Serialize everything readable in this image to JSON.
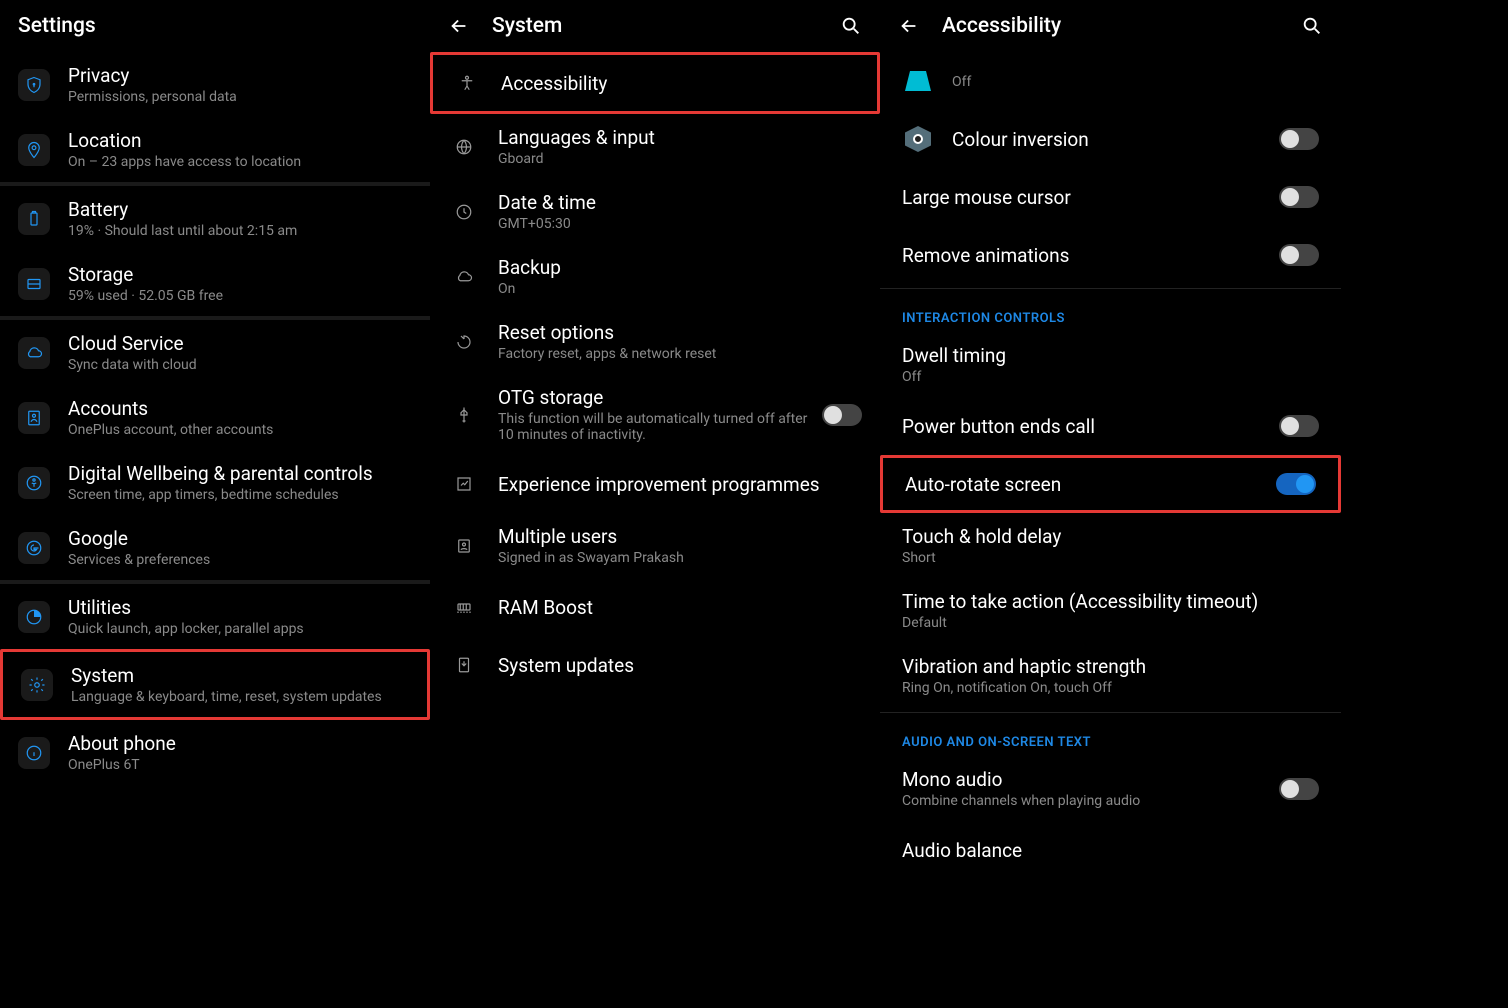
{
  "pane1": {
    "title": "Settings",
    "items": [
      {
        "title": "Privacy",
        "sub": "Permissions, personal data",
        "icon": "shield"
      },
      {
        "title": "Location",
        "sub": "On – 23 apps have access to location",
        "icon": "location"
      },
      {
        "divider": true
      },
      {
        "title": "Battery",
        "sub": "19% · Should last until about 2:15 am",
        "icon": "battery"
      },
      {
        "title": "Storage",
        "sub": "59% used · 52.05 GB free",
        "icon": "storage"
      },
      {
        "divider": true
      },
      {
        "title": "Cloud Service",
        "sub": "Sync data with cloud",
        "icon": "cloud"
      },
      {
        "title": "Accounts",
        "sub": "OnePlus account, other accounts",
        "icon": "accounts"
      },
      {
        "title": "Digital Wellbeing & parental controls",
        "sub": "Screen time, app timers, bedtime schedules",
        "icon": "wellbeing"
      },
      {
        "title": "Google",
        "sub": "Services & preferences",
        "icon": "google"
      },
      {
        "divider": true
      },
      {
        "title": "Utilities",
        "sub": "Quick launch, app locker, parallel apps",
        "icon": "utilities"
      },
      {
        "title": "System",
        "sub": "Language & keyboard, time, reset, system updates",
        "icon": "system",
        "highlight": true
      },
      {
        "title": "About phone",
        "sub": "OnePlus 6T",
        "icon": "info"
      }
    ]
  },
  "pane2": {
    "title": "System",
    "items": [
      {
        "title": "Accessibility",
        "icon": "accessibility",
        "highlight": true
      },
      {
        "title": "Languages & input",
        "sub": "Gboard",
        "icon": "globe"
      },
      {
        "title": "Date & time",
        "sub": "GMT+05:30",
        "icon": "clock"
      },
      {
        "title": "Backup",
        "sub": "On",
        "icon": "cloud"
      },
      {
        "title": "Reset options",
        "sub": "Factory reset, apps & network reset",
        "icon": "reset"
      },
      {
        "title": "OTG storage",
        "sub": "This function will be automatically turned off after 10 minutes of inactivity.",
        "icon": "usb",
        "toggle": "off"
      },
      {
        "title": "Experience improvement programmes",
        "icon": "chart"
      },
      {
        "title": "Multiple users",
        "sub": "Signed in as Swayam Prakash",
        "icon": "users"
      },
      {
        "title": "RAM Boost",
        "icon": "ram"
      },
      {
        "title": "System updates",
        "icon": "download"
      }
    ]
  },
  "pane3": {
    "title": "Accessibility",
    "groups": [
      {
        "items": [
          {
            "title": "",
            "sub": "Off",
            "shape": "trapezoid"
          },
          {
            "title": "Colour inversion",
            "shape": "hexagon",
            "toggle": "off"
          },
          {
            "title": "Large mouse cursor",
            "toggle": "off"
          },
          {
            "title": "Remove animations",
            "toggle": "off"
          }
        ]
      },
      {
        "header": "INTERACTION CONTROLS",
        "items": [
          {
            "title": "Dwell timing",
            "sub": "Off"
          },
          {
            "title": "Power button ends call",
            "toggle": "off"
          },
          {
            "title": "Auto-rotate screen",
            "toggle": "on",
            "highlight": true
          },
          {
            "title": "Touch & hold delay",
            "sub": "Short"
          },
          {
            "title": "Time to take action (Accessibility timeout)",
            "sub": "Default"
          },
          {
            "title": "Vibration and haptic strength",
            "sub": "Ring On, notification On, touch Off"
          }
        ]
      },
      {
        "header": "AUDIO AND ON-SCREEN TEXT",
        "items": [
          {
            "title": "Mono audio",
            "sub": "Combine channels when playing audio",
            "toggle": "off"
          },
          {
            "title": "Audio balance"
          }
        ]
      }
    ]
  }
}
